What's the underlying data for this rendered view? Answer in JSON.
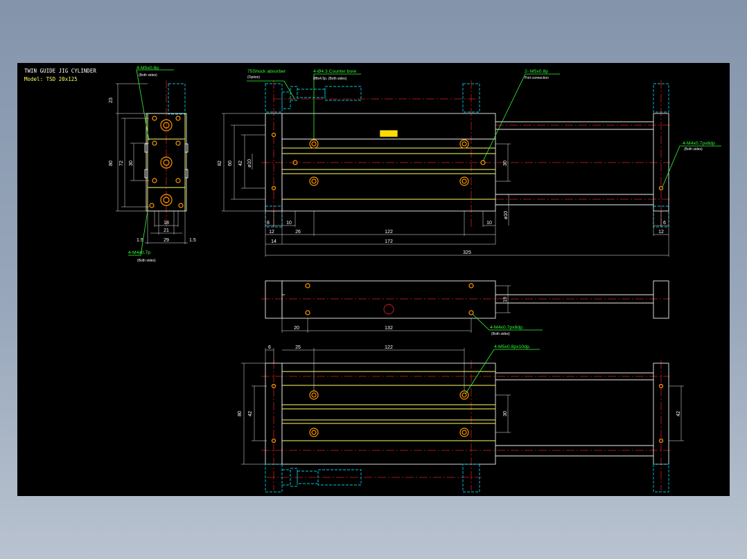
{
  "title_block": {
    "title": "TWIN GUIDE JIG CYLINDER",
    "model": "Model: TSD 20x125"
  },
  "callouts": {
    "side_top_tap": {
      "main": "4-M5x0.8p",
      "sub": "(Both sides)"
    },
    "side_bottom_tap": {
      "main": "4-M4x0.7p",
      "sub": "(Both sides)"
    },
    "shock_absorber": {
      "main": "75Shock absorber",
      "sub": "(Option)"
    },
    "counter_bore": {
      "main": "4-Ø4.3 Counter bore",
      "sub": "Ø8x4.5p. (Both sides)"
    },
    "port": {
      "main": "2- M5x0.8p",
      "sub": "Port connection"
    },
    "end_plate_tap": {
      "main": "4-M4x0.7px8dp",
      "sub": "(Both sides)"
    },
    "bottom_view_tap": {
      "main": "4-M4x0.7px8dp.",
      "sub": "(Both sides)"
    },
    "plan_tap": {
      "main": "4-M5x0.8px10dp."
    }
  },
  "dimensions": {
    "side_view": {
      "d23": "23",
      "d80": "80",
      "d72": "72",
      "d30": "30",
      "d18": "18",
      "d21": "21",
      "d29": "29",
      "d1_5_left": "1.5",
      "d1_5_right": "1.5"
    },
    "front_view": {
      "d82": "82",
      "d60": "60",
      "d42": "42",
      "d10_phi": "ø10",
      "d30": "30",
      "d10_rod": "ø10",
      "d8": "8",
      "d10_left": "10",
      "d12": "12",
      "d26": "26",
      "d122": "122",
      "d10_right": "10",
      "d14": "14",
      "d172": "172",
      "d325": "325",
      "d6": "6",
      "d12_end": "12"
    },
    "bottom_view": {
      "d19": "19",
      "d20": "20",
      "d132": "132"
    },
    "plan_view": {
      "d6": "6",
      "d25": "25",
      "d122": "122",
      "d80": "80",
      "d42_left": "42",
      "d30": "30",
      "d42_right": "42"
    }
  },
  "colors": {
    "background": "#000000",
    "outline": "#ffff66",
    "body_line": "#f0f0f0",
    "hidden_line": "#00c8e0",
    "center_line": "#d42020",
    "leader": "#33ff33",
    "hole": "#ff9a00"
  }
}
